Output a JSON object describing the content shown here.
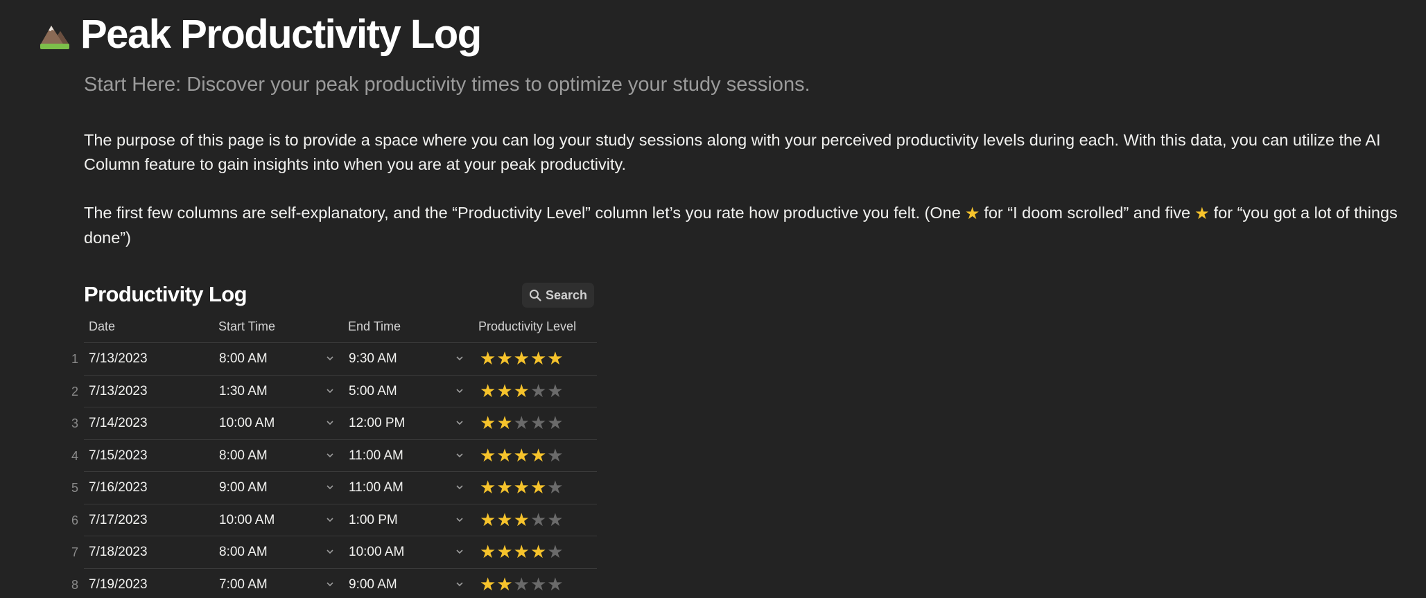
{
  "page": {
    "title": "Peak Productivity Log",
    "subtitle": "Start Here: Discover your peak productivity times to optimize your study sessions.",
    "paragraph1": "The purpose of this page is to provide a space where you can log your study sessions along with your perceived productivity levels during each. With this data, you can utilize the AI Column feature to gain insights into when you are at your peak productivity.",
    "paragraph2_part1": "The first few columns are self-explanatory, and the “Productivity Level” column let’s you rate how productive you felt. (One",
    "paragraph2_part2": "for “I doom scrolled” and five",
    "paragraph2_part3": "for “you got a lot of things done”)",
    "icon": "mountain-icon"
  },
  "database": {
    "title": "Productivity Log",
    "search_label": "Search",
    "columns": [
      "Date",
      "Start Time",
      "End Time",
      "Productivity Level"
    ],
    "rows": [
      {
        "num": "1",
        "date": "7/13/2023",
        "start": "8:00 AM",
        "end": "9:30 AM",
        "rating": 5
      },
      {
        "num": "2",
        "date": "7/13/2023",
        "start": "1:30 AM",
        "end": "5:00 AM",
        "rating": 3
      },
      {
        "num": "3",
        "date": "7/14/2023",
        "start": "10:00 AM",
        "end": "12:00 PM",
        "rating": 2
      },
      {
        "num": "4",
        "date": "7/15/2023",
        "start": "8:00 AM",
        "end": "11:00 AM",
        "rating": 4
      },
      {
        "num": "5",
        "date": "7/16/2023",
        "start": "9:00 AM",
        "end": "11:00 AM",
        "rating": 4
      },
      {
        "num": "6",
        "date": "7/17/2023",
        "start": "10:00 AM",
        "end": "1:00 PM",
        "rating": 3
      },
      {
        "num": "7",
        "date": "7/18/2023",
        "start": "8:00 AM",
        "end": "10:00 AM",
        "rating": 4
      },
      {
        "num": "8",
        "date": "7/19/2023",
        "start": "7:00 AM",
        "end": "9:00 AM",
        "rating": 2
      }
    ],
    "max_rating": 5
  },
  "colors": {
    "background": "#232323",
    "star_on": "#f6c32c",
    "star_off": "#6a6a6a"
  }
}
